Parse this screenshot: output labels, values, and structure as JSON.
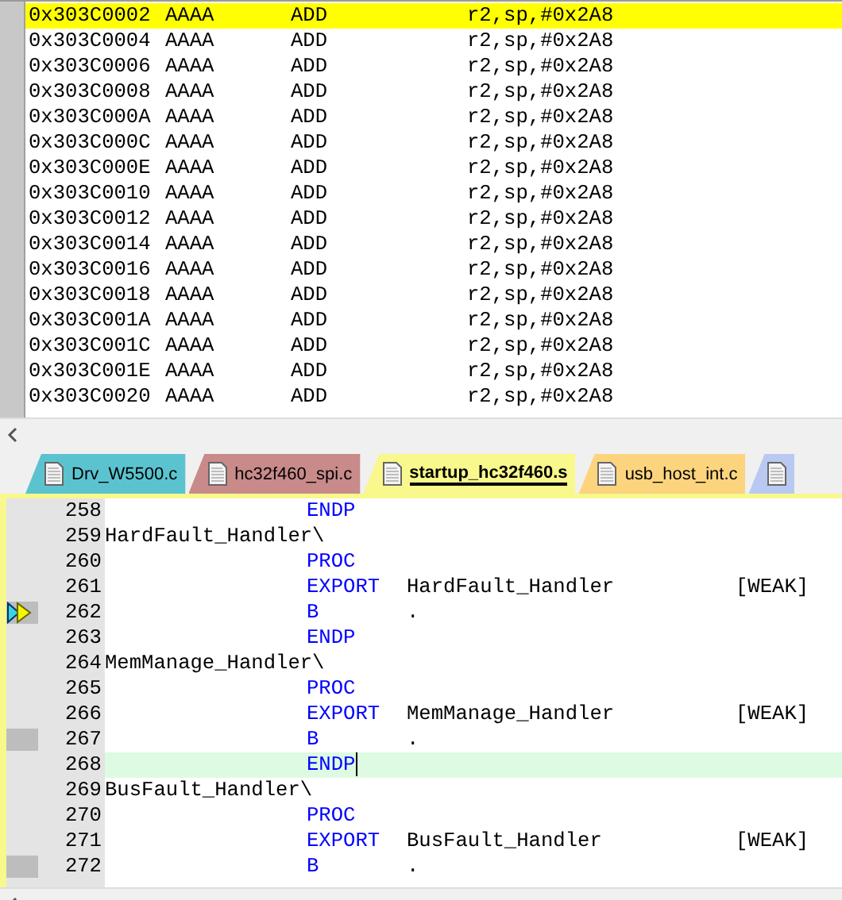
{
  "disassembly": {
    "rows": [
      {
        "address": "0x303C0002",
        "opcode": "AAAA",
        "mnemonic": "ADD",
        "operands": "r2,sp,#0x2A8",
        "selected": true
      },
      {
        "address": "0x303C0004",
        "opcode": "AAAA",
        "mnemonic": "ADD",
        "operands": "r2,sp,#0x2A8",
        "selected": false
      },
      {
        "address": "0x303C0006",
        "opcode": "AAAA",
        "mnemonic": "ADD",
        "operands": "r2,sp,#0x2A8",
        "selected": false
      },
      {
        "address": "0x303C0008",
        "opcode": "AAAA",
        "mnemonic": "ADD",
        "operands": "r2,sp,#0x2A8",
        "selected": false
      },
      {
        "address": "0x303C000A",
        "opcode": "AAAA",
        "mnemonic": "ADD",
        "operands": "r2,sp,#0x2A8",
        "selected": false
      },
      {
        "address": "0x303C000C",
        "opcode": "AAAA",
        "mnemonic": "ADD",
        "operands": "r2,sp,#0x2A8",
        "selected": false
      },
      {
        "address": "0x303C000E",
        "opcode": "AAAA",
        "mnemonic": "ADD",
        "operands": "r2,sp,#0x2A8",
        "selected": false
      },
      {
        "address": "0x303C0010",
        "opcode": "AAAA",
        "mnemonic": "ADD",
        "operands": "r2,sp,#0x2A8",
        "selected": false
      },
      {
        "address": "0x303C0012",
        "opcode": "AAAA",
        "mnemonic": "ADD",
        "operands": "r2,sp,#0x2A8",
        "selected": false
      },
      {
        "address": "0x303C0014",
        "opcode": "AAAA",
        "mnemonic": "ADD",
        "operands": "r2,sp,#0x2A8",
        "selected": false
      },
      {
        "address": "0x303C0016",
        "opcode": "AAAA",
        "mnemonic": "ADD",
        "operands": "r2,sp,#0x2A8",
        "selected": false
      },
      {
        "address": "0x303C0018",
        "opcode": "AAAA",
        "mnemonic": "ADD",
        "operands": "r2,sp,#0x2A8",
        "selected": false
      },
      {
        "address": "0x303C001A",
        "opcode": "AAAA",
        "mnemonic": "ADD",
        "operands": "r2,sp,#0x2A8",
        "selected": false
      },
      {
        "address": "0x303C001C",
        "opcode": "AAAA",
        "mnemonic": "ADD",
        "operands": "r2,sp,#0x2A8",
        "selected": false
      },
      {
        "address": "0x303C001E",
        "opcode": "AAAA",
        "mnemonic": "ADD",
        "operands": "r2,sp,#0x2A8",
        "selected": false
      },
      {
        "address": "0x303C0020",
        "opcode": "AAAA",
        "mnemonic": "ADD",
        "operands": "r2,sp,#0x2A8",
        "selected": false
      }
    ]
  },
  "tabs": [
    {
      "label": "Drv_W5500.c",
      "color": "#5bc3cf",
      "selected": false
    },
    {
      "label": "hc32f460_spi.c",
      "color": "#c98a8a",
      "selected": false
    },
    {
      "label": "startup_hc32f460.s",
      "color": "#f8f88c",
      "selected": true
    },
    {
      "label": "usb_host_int.c",
      "color": "#fdd47e",
      "selected": false
    },
    {
      "color": "#b9c9f2",
      "selected": false
    }
  ],
  "editor": {
    "lines": [
      {
        "number": "258",
        "op": "ENDP",
        "execution_point": false,
        "marked": false,
        "current_line": false
      },
      {
        "number": "259",
        "label": "HardFault_Handler\\",
        "execution_point": false,
        "marked": false,
        "current_line": false
      },
      {
        "number": "260",
        "op": "PROC",
        "execution_point": false,
        "marked": false,
        "current_line": false
      },
      {
        "number": "261",
        "op": "EXPORT",
        "operand": "HardFault_Handler",
        "attribute": "[WEAK]",
        "execution_point": false,
        "marked": false,
        "current_line": false
      },
      {
        "number": "262",
        "op": "B",
        "operand": ".",
        "execution_point": true,
        "marked": true,
        "current_line": false
      },
      {
        "number": "263",
        "op": "ENDP",
        "execution_point": false,
        "marked": false,
        "current_line": false
      },
      {
        "number": "264",
        "label": "MemManage_Handler\\",
        "execution_point": false,
        "marked": false,
        "current_line": false
      },
      {
        "number": "265",
        "op": "PROC",
        "execution_point": false,
        "marked": false,
        "current_line": false
      },
      {
        "number": "266",
        "op": "EXPORT",
        "operand": "MemManage_Handler",
        "attribute": "[WEAK]",
        "execution_point": false,
        "marked": false,
        "current_line": false
      },
      {
        "number": "267",
        "op": "B",
        "operand": ".",
        "execution_point": false,
        "marked": true,
        "current_line": false
      },
      {
        "number": "268",
        "op": "ENDP",
        "execution_point": false,
        "marked": false,
        "current_line": true
      },
      {
        "number": "269",
        "label": "BusFault_Handler\\",
        "execution_point": false,
        "marked": false,
        "current_line": false
      },
      {
        "number": "270",
        "op": "PROC",
        "execution_point": false,
        "marked": false,
        "current_line": false
      },
      {
        "number": "271",
        "op": "EXPORT",
        "operand": "BusFault_Handler",
        "attribute": "[WEAK]",
        "execution_point": false,
        "marked": false,
        "current_line": false
      },
      {
        "number": "272",
        "op": "B",
        "operand": ".",
        "execution_point": false,
        "marked": true,
        "current_line": false
      }
    ]
  }
}
